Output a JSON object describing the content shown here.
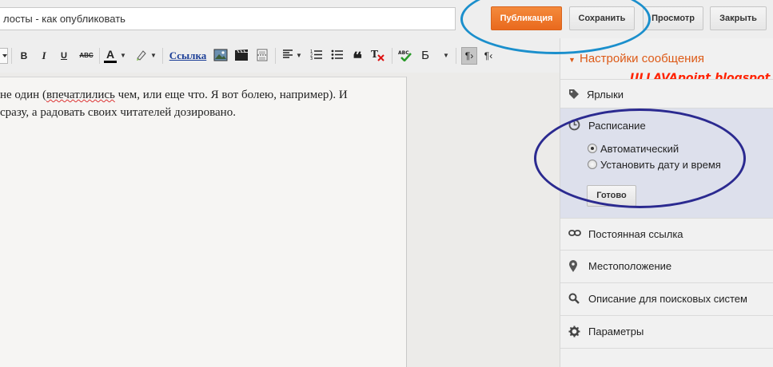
{
  "topbar": {
    "title_value": "лосты - как опубликовать",
    "publish_label": "Публикация",
    "save_label": "Сохранить",
    "preview_label": "Просмотр",
    "close_label": "Закрыть",
    "publish_color": "#ee7422"
  },
  "toolbar": {
    "bold": "B",
    "italic": "I",
    "underline": "U",
    "strike": "ABC",
    "text_color": "A",
    "link_label": "Ссылка",
    "quote": "❝",
    "language_label": "Б",
    "paragraph_rtl": "¶",
    "paragraph_ltr": "¶‹"
  },
  "editor": {
    "line1_before": "не один (",
    "line1_misspelled": "впечатлились",
    "line1_after": " чем, или еще что. Я вот болею, например). И",
    "line2": "сразу, а радовать своих читателей дозировано."
  },
  "sidebar": {
    "header": "Настройки сообщения",
    "watermark": "ULLAVApoint.blogspot.ru",
    "labels_section": "Ярлыки",
    "schedule": {
      "title": "Расписание",
      "options": [
        {
          "label": "Автоматический",
          "selected": true
        },
        {
          "label": "Установить дату и время",
          "selected": false
        }
      ],
      "done_label": "Готово"
    },
    "permalink_label": "Постоянная ссылка",
    "location_label": "Местоположение",
    "search_desc_label": "Описание для поисковых систем",
    "options_label": "Параметры",
    "accent_color": "#dd5a17",
    "annotation_colors": [
      "#1b8fcc",
      "#2b2a90"
    ]
  }
}
